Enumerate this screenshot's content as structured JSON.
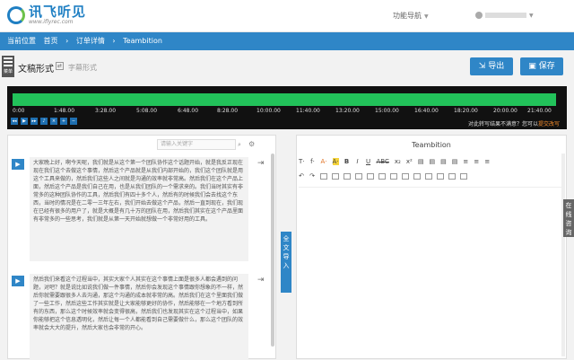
{
  "header": {
    "logo_text": "讯飞听见",
    "logo_url": "www.iflyrec.com",
    "func_nav": "功能导航"
  },
  "breadcrumb": {
    "current_label": "当前位置",
    "home": "首页",
    "sep1": "›",
    "order": "订单详情",
    "sep2": "›",
    "file": "Teambition"
  },
  "toolbar": {
    "menu_label": "菜单",
    "mode_active": "文稿形式",
    "mode_inactive": "字幕形式",
    "export_label": "导出",
    "save_label": "保存"
  },
  "player": {
    "ticks": [
      "0:00",
      "1:48.00",
      "3:28.00",
      "5:08.00",
      "6:48.00",
      "8:28.00",
      "10:00.00",
      "11:40.00",
      "13:20.00",
      "15:00.00",
      "16:40.00",
      "18:20.00",
      "20:00.00",
      "21:40.00"
    ],
    "note_prefix": "对此转写结果不满意？您可以",
    "note_link": "提交改写"
  },
  "left": {
    "search_placeholder": "请输入关键字",
    "para1": "大家晚上好，啊今天呢，我们就是从这个第一个团队协作这个话题开始，就是我反正现在现在我们这个去做这个事情，然后这个产品就是从我们内部开始的，我们这个团队就是用这个工具来做的，然后我们这些人之间就是沟通的效率就非常高。然后我们在这个产品上面，然后这个产品是我们自己在用，也是从我们团队的一个需求来的。我们当时其实有非常多的这种团队协作的工具，然后我们有四十多个人，然后有的时候我们会去找这个东西，当时的情况是在二零一三年左右，我们开始去做这个产品，然后一直到现在，我们现在已经有很多的用户了，就是大概是有几十万的团队在用，然后我们其实在这个产品里面有非常多的一些思考，我们就是从第一天开始就想做一个非常好用的工具。",
    "para2": "然后我们来看这个过程当中，其实大家个人其实在这个事情上面是很多人都会遇到的问题，对吧？就是说比如说我们做一件事情，然后你会发现这个事情跟你想象的不一样，然后你就需要跟很多人去沟通，那这个沟通的成本就非常的高。然后我们在这个里面我们做了一些工作，然后这些工作其实就是让大家能够更好的协作，然后能够在一个地方看到所有的东西，那么这个时候效率就会变得很高，然后我们也发现其实在这个过程当中，如果你能够把这个信息透明化，然后让每一个人都能看到自己需要做什么，那么这个团队的效率就会大大的提升，然后大家也会非常的开心。"
  },
  "import_label": "全文导入",
  "right": {
    "doc_title": "Teambition",
    "tools_row1": [
      "T·",
      "f·",
      "A·",
      "A·",
      "B",
      "I",
      "U",
      "ABC",
      "x₂",
      "x²",
      "▤",
      "▤",
      "▤",
      "▤",
      "≡",
      "≡",
      "≡"
    ],
    "tools_row2": [
      "↶",
      "↷",
      "⧉",
      "⧉",
      "⧉",
      "⧉",
      "⧉",
      "⧉",
      "⧉",
      "⧉",
      "⧉",
      "⧉",
      "⧉",
      "⧉",
      "⧉"
    ]
  },
  "side_tab": "在线咨询"
}
